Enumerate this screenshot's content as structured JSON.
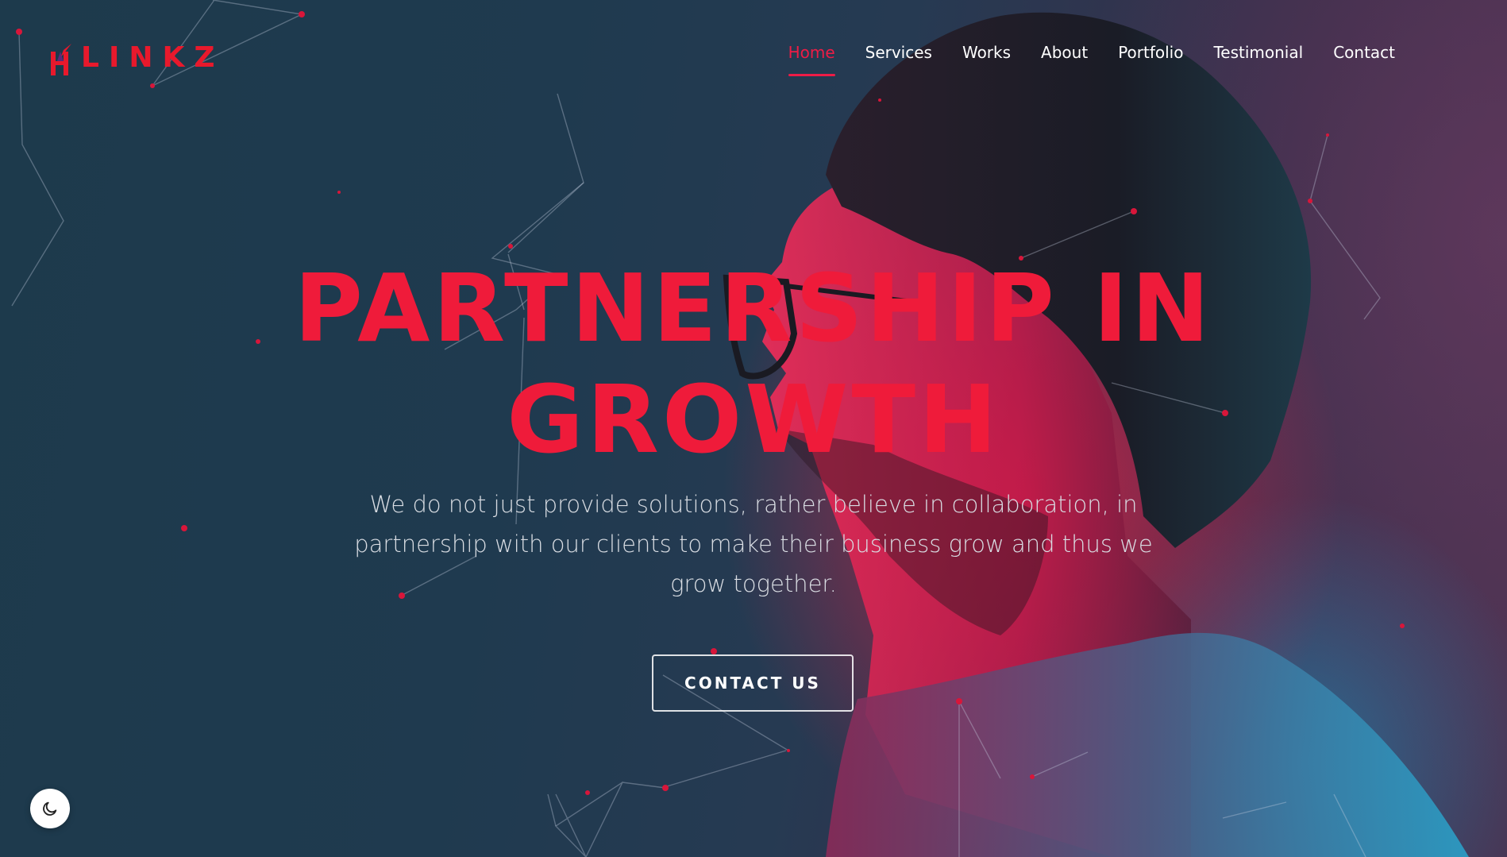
{
  "brand": {
    "logo_text": "LINKZ",
    "logo_alt_initial": "H"
  },
  "nav": {
    "items": [
      {
        "label": "Home",
        "active": true
      },
      {
        "label": "Services",
        "active": false
      },
      {
        "label": "Works",
        "active": false
      },
      {
        "label": "About",
        "active": false
      },
      {
        "label": "Portfolio",
        "active": false
      },
      {
        "label": "Testimonial",
        "active": false
      },
      {
        "label": "Contact",
        "active": false
      }
    ]
  },
  "hero": {
    "headline_line1": "PARTNERSHIP IN",
    "headline_line2": "GROWTH",
    "subtitle": "We do not just provide solutions, rather believe in collaboration, in partnership with our clients to make their business grow and thus we grow together.",
    "cta_label": "CONTACT US"
  },
  "theme_toggle": {
    "icon": "moon-icon"
  },
  "colors": {
    "accent": "#ee1c46",
    "headline": "#ef1b3a",
    "background": "#1f3a4f"
  }
}
